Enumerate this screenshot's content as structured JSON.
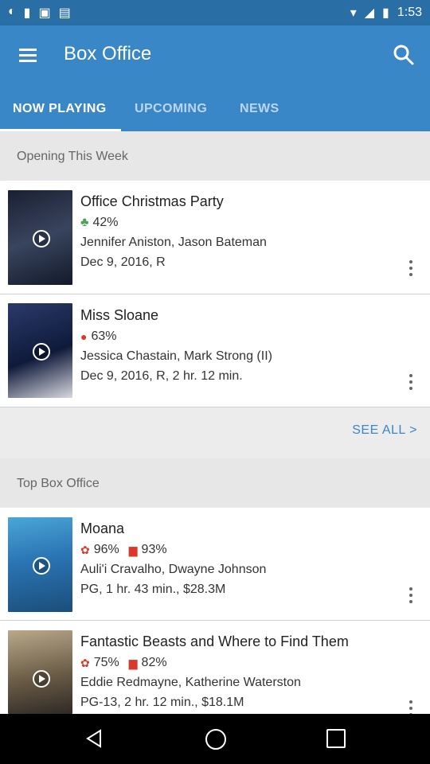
{
  "status_bar": {
    "time": "1:53"
  },
  "app_bar": {
    "title": "Box Office"
  },
  "tabs": [
    {
      "label": "NOW PLAYING"
    },
    {
      "label": "UPCOMING"
    },
    {
      "label": "NEWS"
    }
  ],
  "sections": {
    "opening": "Opening This Week",
    "top": "Top Box Office",
    "see_all": "SEE ALL  >"
  },
  "opening_movies": [
    {
      "title": "Office Christmas Party",
      "rating": "42%",
      "cast": "Jennifer Aniston, Jason Bateman",
      "details": "Dec 9, 2016, R"
    },
    {
      "title": "Miss Sloane",
      "rating": "63%",
      "cast": "Jessica Chastain, Mark Strong (II)",
      "details": "Dec 9, 2016, R, 2 hr. 12 min."
    }
  ],
  "top_movies": [
    {
      "title": "Moana",
      "critic": "96%",
      "audience": "93%",
      "cast": "Auli'i Cravalho, Dwayne Johnson",
      "details": "PG, 1 hr. 43 min., $28.3M"
    },
    {
      "title": "Fantastic Beasts and Where to Find Them",
      "critic": "75%",
      "audience": "82%",
      "cast": "Eddie Redmayne, Katherine Waterston",
      "details": "PG-13, 2 hr. 12 min., $18.1M"
    }
  ],
  "colors": {
    "primary": "#3a87c8",
    "status": "#2a6ea6",
    "accent": "#3a87c8"
  }
}
